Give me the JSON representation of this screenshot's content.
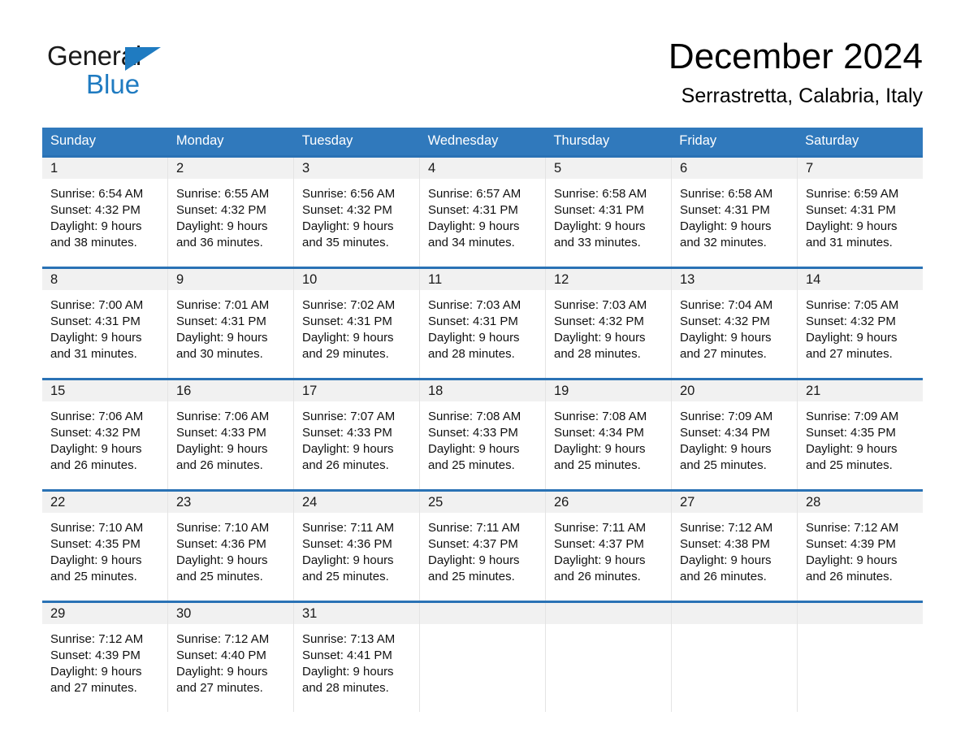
{
  "brand": {
    "name_part1": "General",
    "name_part2": "Blue",
    "triangle_color": "#1f7bc1"
  },
  "header": {
    "month_title": "December 2024",
    "location": "Serrastretta, Calabria, Italy"
  },
  "theme": {
    "header_blue": "#3079bc",
    "row_rule_blue": "#2a72b5",
    "day_band_gray": "#f1f1f1",
    "cell_border_gray": "#e4e4e4"
  },
  "weekdays": [
    "Sunday",
    "Monday",
    "Tuesday",
    "Wednesday",
    "Thursday",
    "Friday",
    "Saturday"
  ],
  "weeks": [
    [
      {
        "day": "1",
        "sunrise": "Sunrise: 6:54 AM",
        "sunset": "Sunset: 4:32 PM",
        "daylight1": "Daylight: 9 hours",
        "daylight2": "and 38 minutes."
      },
      {
        "day": "2",
        "sunrise": "Sunrise: 6:55 AM",
        "sunset": "Sunset: 4:32 PM",
        "daylight1": "Daylight: 9 hours",
        "daylight2": "and 36 minutes."
      },
      {
        "day": "3",
        "sunrise": "Sunrise: 6:56 AM",
        "sunset": "Sunset: 4:32 PM",
        "daylight1": "Daylight: 9 hours",
        "daylight2": "and 35 minutes."
      },
      {
        "day": "4",
        "sunrise": "Sunrise: 6:57 AM",
        "sunset": "Sunset: 4:31 PM",
        "daylight1": "Daylight: 9 hours",
        "daylight2": "and 34 minutes."
      },
      {
        "day": "5",
        "sunrise": "Sunrise: 6:58 AM",
        "sunset": "Sunset: 4:31 PM",
        "daylight1": "Daylight: 9 hours",
        "daylight2": "and 33 minutes."
      },
      {
        "day": "6",
        "sunrise": "Sunrise: 6:58 AM",
        "sunset": "Sunset: 4:31 PM",
        "daylight1": "Daylight: 9 hours",
        "daylight2": "and 32 minutes."
      },
      {
        "day": "7",
        "sunrise": "Sunrise: 6:59 AM",
        "sunset": "Sunset: 4:31 PM",
        "daylight1": "Daylight: 9 hours",
        "daylight2": "and 31 minutes."
      }
    ],
    [
      {
        "day": "8",
        "sunrise": "Sunrise: 7:00 AM",
        "sunset": "Sunset: 4:31 PM",
        "daylight1": "Daylight: 9 hours",
        "daylight2": "and 31 minutes."
      },
      {
        "day": "9",
        "sunrise": "Sunrise: 7:01 AM",
        "sunset": "Sunset: 4:31 PM",
        "daylight1": "Daylight: 9 hours",
        "daylight2": "and 30 minutes."
      },
      {
        "day": "10",
        "sunrise": "Sunrise: 7:02 AM",
        "sunset": "Sunset: 4:31 PM",
        "daylight1": "Daylight: 9 hours",
        "daylight2": "and 29 minutes."
      },
      {
        "day": "11",
        "sunrise": "Sunrise: 7:03 AM",
        "sunset": "Sunset: 4:31 PM",
        "daylight1": "Daylight: 9 hours",
        "daylight2": "and 28 minutes."
      },
      {
        "day": "12",
        "sunrise": "Sunrise: 7:03 AM",
        "sunset": "Sunset: 4:32 PM",
        "daylight1": "Daylight: 9 hours",
        "daylight2": "and 28 minutes."
      },
      {
        "day": "13",
        "sunrise": "Sunrise: 7:04 AM",
        "sunset": "Sunset: 4:32 PM",
        "daylight1": "Daylight: 9 hours",
        "daylight2": "and 27 minutes."
      },
      {
        "day": "14",
        "sunrise": "Sunrise: 7:05 AM",
        "sunset": "Sunset: 4:32 PM",
        "daylight1": "Daylight: 9 hours",
        "daylight2": "and 27 minutes."
      }
    ],
    [
      {
        "day": "15",
        "sunrise": "Sunrise: 7:06 AM",
        "sunset": "Sunset: 4:32 PM",
        "daylight1": "Daylight: 9 hours",
        "daylight2": "and 26 minutes."
      },
      {
        "day": "16",
        "sunrise": "Sunrise: 7:06 AM",
        "sunset": "Sunset: 4:33 PM",
        "daylight1": "Daylight: 9 hours",
        "daylight2": "and 26 minutes."
      },
      {
        "day": "17",
        "sunrise": "Sunrise: 7:07 AM",
        "sunset": "Sunset: 4:33 PM",
        "daylight1": "Daylight: 9 hours",
        "daylight2": "and 26 minutes."
      },
      {
        "day": "18",
        "sunrise": "Sunrise: 7:08 AM",
        "sunset": "Sunset: 4:33 PM",
        "daylight1": "Daylight: 9 hours",
        "daylight2": "and 25 minutes."
      },
      {
        "day": "19",
        "sunrise": "Sunrise: 7:08 AM",
        "sunset": "Sunset: 4:34 PM",
        "daylight1": "Daylight: 9 hours",
        "daylight2": "and 25 minutes."
      },
      {
        "day": "20",
        "sunrise": "Sunrise: 7:09 AM",
        "sunset": "Sunset: 4:34 PM",
        "daylight1": "Daylight: 9 hours",
        "daylight2": "and 25 minutes."
      },
      {
        "day": "21",
        "sunrise": "Sunrise: 7:09 AM",
        "sunset": "Sunset: 4:35 PM",
        "daylight1": "Daylight: 9 hours",
        "daylight2": "and 25 minutes."
      }
    ],
    [
      {
        "day": "22",
        "sunrise": "Sunrise: 7:10 AM",
        "sunset": "Sunset: 4:35 PM",
        "daylight1": "Daylight: 9 hours",
        "daylight2": "and 25 minutes."
      },
      {
        "day": "23",
        "sunrise": "Sunrise: 7:10 AM",
        "sunset": "Sunset: 4:36 PM",
        "daylight1": "Daylight: 9 hours",
        "daylight2": "and 25 minutes."
      },
      {
        "day": "24",
        "sunrise": "Sunrise: 7:11 AM",
        "sunset": "Sunset: 4:36 PM",
        "daylight1": "Daylight: 9 hours",
        "daylight2": "and 25 minutes."
      },
      {
        "day": "25",
        "sunrise": "Sunrise: 7:11 AM",
        "sunset": "Sunset: 4:37 PM",
        "daylight1": "Daylight: 9 hours",
        "daylight2": "and 25 minutes."
      },
      {
        "day": "26",
        "sunrise": "Sunrise: 7:11 AM",
        "sunset": "Sunset: 4:37 PM",
        "daylight1": "Daylight: 9 hours",
        "daylight2": "and 26 minutes."
      },
      {
        "day": "27",
        "sunrise": "Sunrise: 7:12 AM",
        "sunset": "Sunset: 4:38 PM",
        "daylight1": "Daylight: 9 hours",
        "daylight2": "and 26 minutes."
      },
      {
        "day": "28",
        "sunrise": "Sunrise: 7:12 AM",
        "sunset": "Sunset: 4:39 PM",
        "daylight1": "Daylight: 9 hours",
        "daylight2": "and 26 minutes."
      }
    ],
    [
      {
        "day": "29",
        "sunrise": "Sunrise: 7:12 AM",
        "sunset": "Sunset: 4:39 PM",
        "daylight1": "Daylight: 9 hours",
        "daylight2": "and 27 minutes."
      },
      {
        "day": "30",
        "sunrise": "Sunrise: 7:12 AM",
        "sunset": "Sunset: 4:40 PM",
        "daylight1": "Daylight: 9 hours",
        "daylight2": "and 27 minutes."
      },
      {
        "day": "31",
        "sunrise": "Sunrise: 7:13 AM",
        "sunset": "Sunset: 4:41 PM",
        "daylight1": "Daylight: 9 hours",
        "daylight2": "and 28 minutes."
      },
      {
        "day": "",
        "sunrise": "",
        "sunset": "",
        "daylight1": "",
        "daylight2": ""
      },
      {
        "day": "",
        "sunrise": "",
        "sunset": "",
        "daylight1": "",
        "daylight2": ""
      },
      {
        "day": "",
        "sunrise": "",
        "sunset": "",
        "daylight1": "",
        "daylight2": ""
      },
      {
        "day": "",
        "sunrise": "",
        "sunset": "",
        "daylight1": "",
        "daylight2": ""
      }
    ]
  ]
}
